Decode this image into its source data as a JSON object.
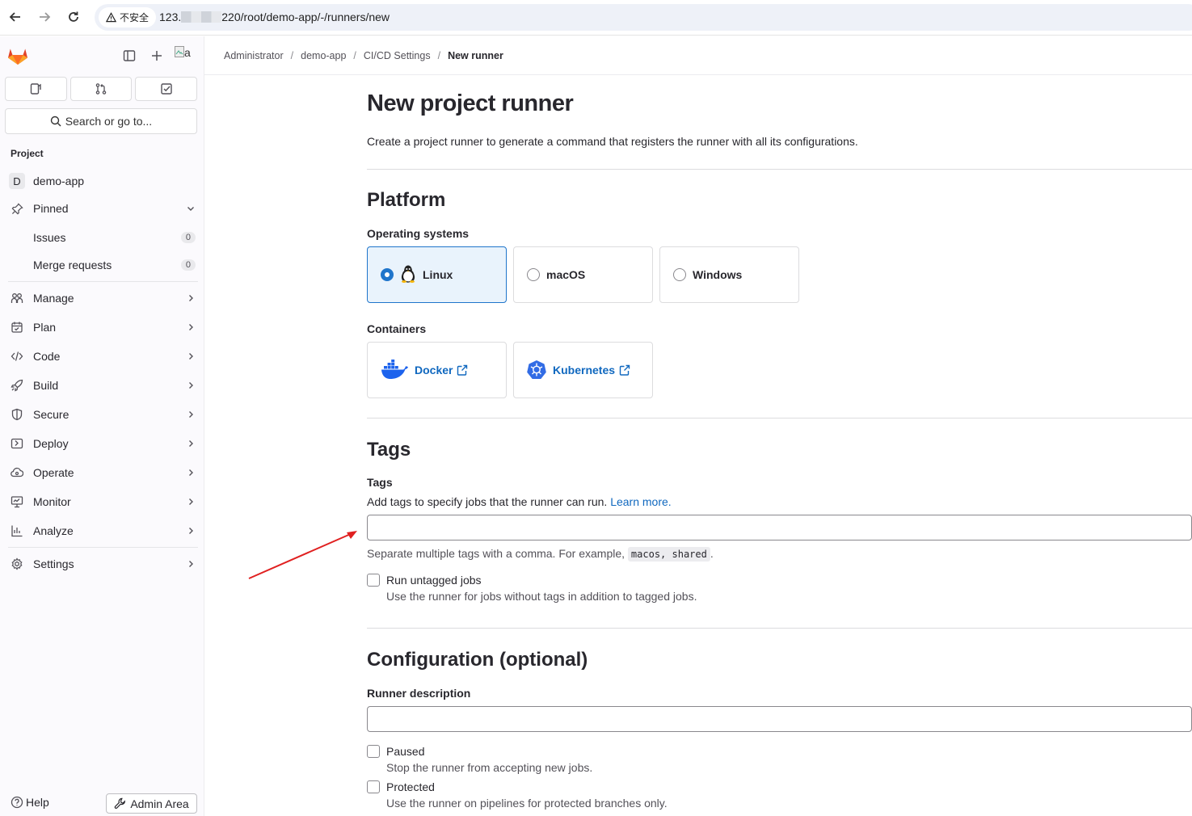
{
  "browser": {
    "insecure_label": "不安全",
    "url_prefix": "123.",
    "url_suffix": "220/root/demo-app/-/runners/new"
  },
  "sidebar": {
    "avatar_alt": "a",
    "search_label": "Search or go to...",
    "section_label": "Project",
    "project_initial": "D",
    "project_name": "demo-app",
    "pinned_label": "Pinned",
    "pinned_items": [
      {
        "label": "Issues",
        "count": "0"
      },
      {
        "label": "Merge requests",
        "count": "0"
      }
    ],
    "nav_items": [
      {
        "label": "Manage",
        "icon": "users-icon"
      },
      {
        "label": "Plan",
        "icon": "calendar-icon"
      },
      {
        "label": "Code",
        "icon": "code-icon"
      },
      {
        "label": "Build",
        "icon": "rocket-icon"
      },
      {
        "label": "Secure",
        "icon": "shield-icon"
      },
      {
        "label": "Deploy",
        "icon": "deploy-icon"
      },
      {
        "label": "Operate",
        "icon": "cloud-gear-icon"
      },
      {
        "label": "Monitor",
        "icon": "monitor-icon"
      },
      {
        "label": "Analyze",
        "icon": "chart-icon"
      }
    ],
    "settings_label": "Settings",
    "help_label": "Help",
    "admin_label": "Admin Area"
  },
  "breadcrumb": [
    "Administrator",
    "demo-app",
    "CI/CD Settings",
    "New runner"
  ],
  "main": {
    "title": "New project runner",
    "description": "Create a project runner to generate a command that registers the runner with all its configurations.",
    "platform": {
      "title": "Platform",
      "os_label": "Operating systems",
      "os_options": [
        {
          "label": "Linux",
          "selected": true
        },
        {
          "label": "macOS",
          "selected": false
        },
        {
          "label": "Windows",
          "selected": false
        }
      ],
      "containers_label": "Containers",
      "containers": [
        {
          "label": "Docker"
        },
        {
          "label": "Kubernetes"
        }
      ]
    },
    "tags": {
      "title": "Tags",
      "field_label": "Tags",
      "description": "Add tags to specify jobs that the runner can run.",
      "learn_more": "Learn more.",
      "input_value": "",
      "help_prefix": "Separate multiple tags with a comma. For example,",
      "help_example": "macos, shared",
      "help_suffix": ".",
      "untagged_label": "Run untagged jobs",
      "untagged_help": "Use the runner for jobs without tags in addition to tagged jobs.",
      "untagged_checked": false
    },
    "configuration": {
      "title": "Configuration (optional)",
      "description_label": "Runner description",
      "description_value": "",
      "paused_label": "Paused",
      "paused_help": "Stop the runner from accepting new jobs.",
      "paused_checked": false,
      "protected_label": "Protected",
      "protected_help": "Use the runner on pipelines for protected branches only.",
      "protected_checked": false
    }
  },
  "colors": {
    "accent": "#1f75cb",
    "link": "#1068bf",
    "annotation_arrow": "#e02020"
  }
}
